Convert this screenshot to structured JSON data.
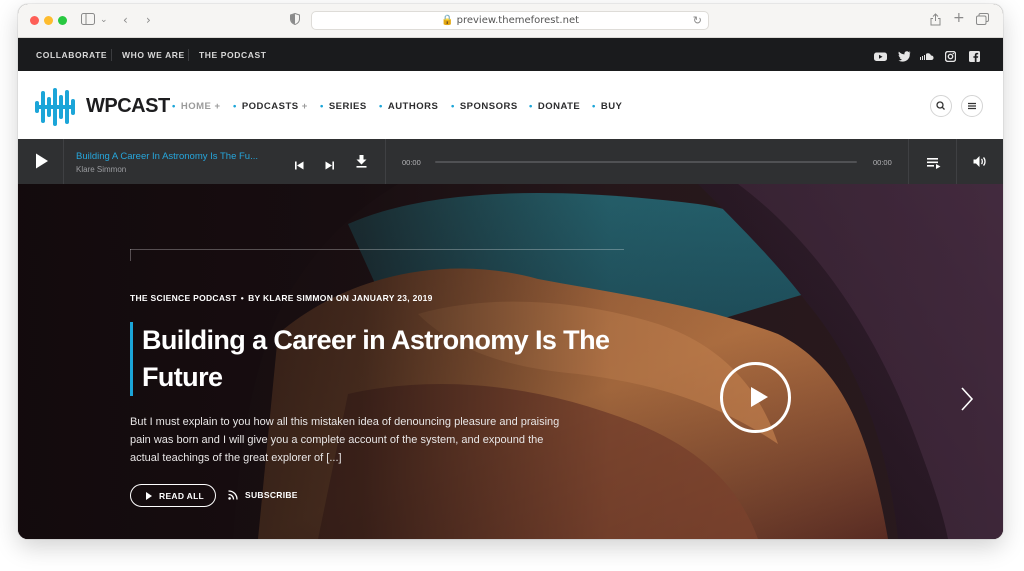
{
  "browser": {
    "url": "preview.themeforest.net"
  },
  "topbar": {
    "links": [
      "COLLABORATE",
      "WHO WE ARE",
      "THE PODCAST"
    ],
    "social_icons": [
      "youtube-icon",
      "twitter-icon",
      "soundcloud-icon",
      "instagram-icon",
      "facebook-icon"
    ]
  },
  "header": {
    "logo_text": "WPCAST",
    "nav": [
      {
        "label": "HOME",
        "has_submenu": true,
        "active": true
      },
      {
        "label": "PODCASTS",
        "has_submenu": true,
        "active": false
      },
      {
        "label": "SERIES",
        "has_submenu": false,
        "active": false
      },
      {
        "label": "AUTHORS",
        "has_submenu": false,
        "active": false
      },
      {
        "label": "SPONSORS",
        "has_submenu": false,
        "active": false
      },
      {
        "label": "DONATE",
        "has_submenu": false,
        "active": false
      },
      {
        "label": "BUY",
        "has_submenu": false,
        "active": false
      }
    ],
    "submenu_marker": "+",
    "nav_dot": "•"
  },
  "player": {
    "track_title": "Building A Career In Astronomy Is The Fu...",
    "track_author": "Klare Simmon",
    "current_time": "00:00",
    "duration": "00:00",
    "progress": 0
  },
  "hero": {
    "category": "THE SCIENCE PODCAST",
    "meta_separator": "•",
    "byline": "BY KLARE SIMMON ON JANUARY 23, 2019",
    "title": "Building a Career in Astronomy Is The Future",
    "excerpt": "But I must explain to you how all this mistaken idea of denouncing pleasure and praising pain was born and I will give you a complete account of the system, and expound the actual teachings of the great explorer of [...]",
    "read_all_label": "READ ALL",
    "subscribe_label": "SUBSCRIBE"
  },
  "colors": {
    "accent": "#1ba5d8",
    "topbar_bg": "#1a1b1d",
    "player_bg": "#2f3032"
  }
}
